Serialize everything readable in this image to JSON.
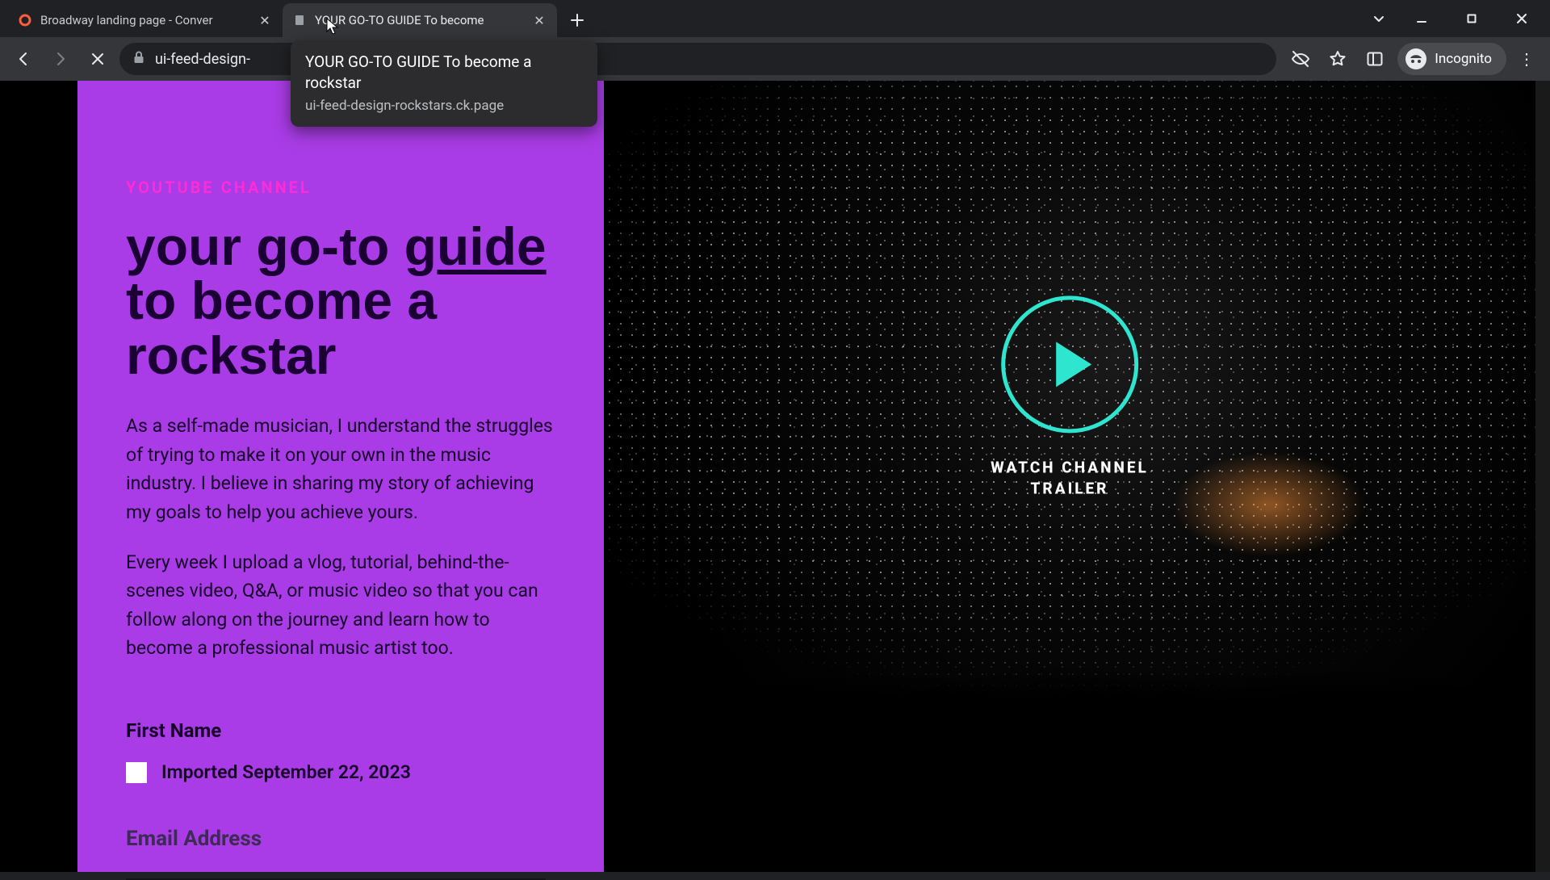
{
  "tabs": [
    {
      "title": "Broadway landing page - Conver",
      "favicon": "o"
    },
    {
      "title": "YOUR GO-TO GUIDE To become",
      "favicon": "page"
    }
  ],
  "toolbar": {
    "url": "ui-feed-design-"
  },
  "tab_tooltip": {
    "title": "YOUR GO-TO GUIDE To become a rockstar",
    "url": "ui-feed-design-rockstars.ck.page"
  },
  "incognito_label": "Incognito",
  "page": {
    "eyebrow": "YOUTUBE CHANNEL",
    "headline_pre": "your go-to ",
    "headline_guide": "guide",
    "headline_post": " to become a rockstar",
    "para1": "As a self-made musician, I understand the struggles of trying to make it on your own in the music industry. I believe in sharing my story of achieving my goals to help you achieve yours.",
    "para2": "Every week I upload a vlog, tutorial, behind-the-scenes video, Q&A, or music video so that you can follow along on the journey and learn how to become a professional music artist too.",
    "first_name_label": "First Name",
    "checkbox_label": "Imported September 22, 2023",
    "email_label": "Email Address",
    "watch_label_l1": "WATCH CHANNEL",
    "watch_label_l2": "TRAILER"
  },
  "colors": {
    "purple": "#a93ce6",
    "magenta": "#ff2bd6",
    "teal": "#2ee6d0"
  }
}
